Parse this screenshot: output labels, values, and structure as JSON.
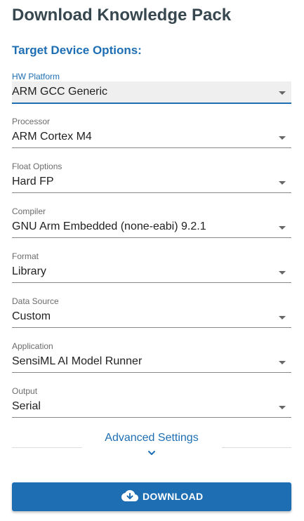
{
  "page": {
    "title": "Download Knowledge Pack",
    "subtitle": "Target Device Options:"
  },
  "fields": [
    {
      "label": "HW Platform",
      "value": "ARM GCC Generic",
      "active": true
    },
    {
      "label": "Processor",
      "value": "ARM Cortex M4"
    },
    {
      "label": "Float Options",
      "value": "Hard FP"
    },
    {
      "label": "Compiler",
      "value": "GNU Arm Embedded (none-eabi) 9.2.1"
    },
    {
      "label": "Format",
      "value": "Library"
    },
    {
      "label": "Data Source",
      "value": "Custom"
    },
    {
      "label": "Application",
      "value": "SensiML AI Model Runner"
    },
    {
      "label": "Output",
      "value": "Serial"
    }
  ],
  "advanced": {
    "label": "Advanced Settings",
    "icon": "chevron-down-icon"
  },
  "download": {
    "label": "DOWNLOAD",
    "icon": "cloud-download-icon"
  },
  "colors": {
    "accent": "#1e6eb4",
    "title": "#37474f"
  }
}
